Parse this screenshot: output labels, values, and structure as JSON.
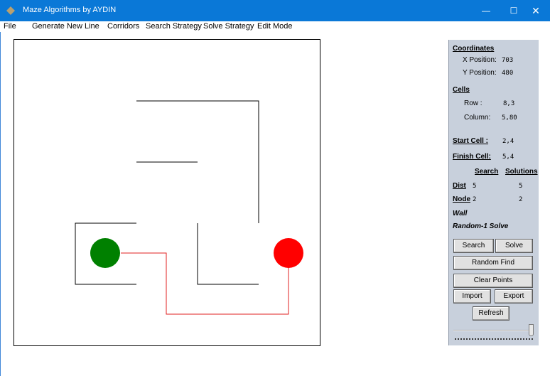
{
  "window": {
    "title": "Maze Algorithms by AYDIN",
    "minimize": "—",
    "maximize": "☐",
    "close": "✕"
  },
  "menu": [
    "File",
    "Generate New",
    "Line",
    "Corridors",
    "Search Strategy",
    "Solve Strategy",
    "Edit Mode"
  ],
  "panel": {
    "coordinates_heading": "Coordinates",
    "x_label": "X Position:",
    "x_value": "703",
    "y_label": "Y Position:",
    "y_value": "480",
    "cells_heading": "Cells",
    "row_label": "Row  :",
    "row_value": "8,3",
    "column_label": "Column:",
    "column_value": "5,80",
    "start_cell_label": "Start Cell :",
    "start_cell_value": "2,4",
    "finish_cell_label": "Finish Cell:",
    "finish_cell_value": "5,4",
    "search_heading": "Search",
    "solutions_heading": "Solutions",
    "dist_label": "Dist",
    "dist_search": "5",
    "dist_solutions": "5",
    "node_label": "Node",
    "node_search": "2",
    "node_solutions": "2",
    "mode_text": "Wall",
    "solve_text": "Random-1 Solve",
    "buttons": {
      "search": "Search",
      "solve": "Solve",
      "random_find": "Random Find",
      "clear_points": "Clear Points",
      "import": "Import",
      "export": "Export",
      "refresh": "Refresh"
    }
  },
  "maze": {
    "start_color": "#008000",
    "finish_color": "#ff0000",
    "path_color": "#e02020",
    "wall_color": "#000000"
  },
  "colors": {
    "titlebar": "#0a78d7",
    "panel_background": "#c8d0dc"
  }
}
